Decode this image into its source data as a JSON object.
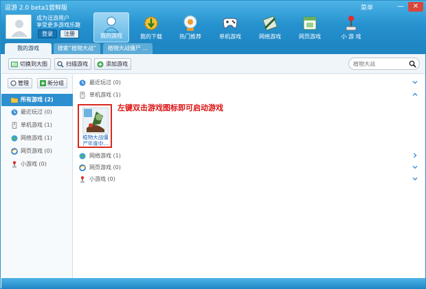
{
  "app": {
    "title": "逗游 2.0 beta1尝鲜版",
    "menu": "菜单",
    "minimize": "—",
    "close": "✕"
  },
  "user": {
    "line1": "成为逗游用户",
    "line2": "享受更多游戏乐趣",
    "login": "登录",
    "register": "注册"
  },
  "nav": [
    {
      "label": "我的游戏",
      "icon": "my-games-icon"
    },
    {
      "label": "我的下载",
      "icon": "download-gear-icon"
    },
    {
      "label": "热门推荐",
      "icon": "hot-recommend-icon"
    },
    {
      "label": "单机游戏",
      "icon": "gamepad-icon"
    },
    {
      "label": "网络游戏",
      "icon": "online-game-icon"
    },
    {
      "label": "网页游戏",
      "icon": "web-game-icon"
    },
    {
      "label": "小 游 戏",
      "icon": "joystick-icon"
    }
  ],
  "tabs": [
    "我的游戏",
    "搜索“植物大战”",
    "植物大战僵尸 ..."
  ],
  "toolbar": {
    "switch": "切换到大图",
    "scan": "扫描游戏",
    "add": "添加游戏",
    "search_placeholder": "植物大战"
  },
  "sidebar": {
    "manage": "管理",
    "new_group": "新分组",
    "items": [
      {
        "label": "所有游戏 (2)",
        "icon": "folder-icon"
      },
      {
        "label": "最近玩过 (0)",
        "icon": "clock-icon"
      },
      {
        "label": "单机游戏 (1)",
        "icon": "computer-icon"
      },
      {
        "label": "网络游戏 (1)",
        "icon": "globe-icon"
      },
      {
        "label": "网页游戏 (0)",
        "icon": "ie-icon"
      },
      {
        "label": "小游戏 (0)",
        "icon": "joystick-icon"
      }
    ]
  },
  "groups": [
    {
      "label": "最近玩过 (0)",
      "icon": "clock-icon",
      "chevron": "down"
    },
    {
      "label": "单机游戏 (1)",
      "icon": "computer-icon",
      "chevron": "up"
    },
    {
      "label": "网络游戏 (1)",
      "icon": "globe-icon",
      "chevron": "right"
    },
    {
      "label": "网页游戏 (0)",
      "icon": "ie-icon",
      "chevron": "down"
    },
    {
      "label": "小游戏 (0)",
      "icon": "joystick-icon",
      "chevron": "down"
    }
  ],
  "game": {
    "name_line1": "植物大战僵",
    "name_line2": "尸年度中..."
  },
  "hint": "左键双击游戏图标即可启动游戏",
  "colors": {
    "accent": "#2592cf",
    "highlight": "#d9261c",
    "selected": "#2d8fd0"
  }
}
